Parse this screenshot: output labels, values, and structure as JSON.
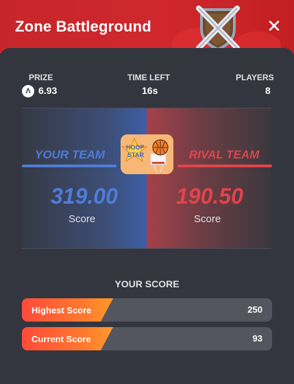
{
  "header": {
    "title": "Zone Battleground",
    "close_symbol": "✕"
  },
  "stats": {
    "prize_label": "PRIZE",
    "prize_value": "6.93",
    "time_label": "TIME LEFT",
    "time_value": "16s",
    "players_label": "PLAYERS",
    "players_value": "8"
  },
  "teams": {
    "your": {
      "label": "YOUR TEAM",
      "score": "319.00",
      "score_caption": "Score",
      "color": "#4f7cd8"
    },
    "rival": {
      "label": "RIVAL TEAM",
      "score": "190.50",
      "score_caption": "Score",
      "color": "#e3434b"
    }
  },
  "game_icon": {
    "line1": "HOOP",
    "line2": "STAR"
  },
  "your_score": {
    "title": "YOUR SCORE",
    "rows": [
      {
        "label": "Highest Score",
        "value": "250"
      },
      {
        "label": "Current Score",
        "value": "93"
      }
    ]
  },
  "colors": {
    "accent_orange": "#ff7b2e",
    "header_red": "#d0282c",
    "panel_bg": "#33363e"
  },
  "icons": {
    "prize": "token-icon",
    "close": "close-icon",
    "emblem": "crossed-swords-shield-icon"
  }
}
